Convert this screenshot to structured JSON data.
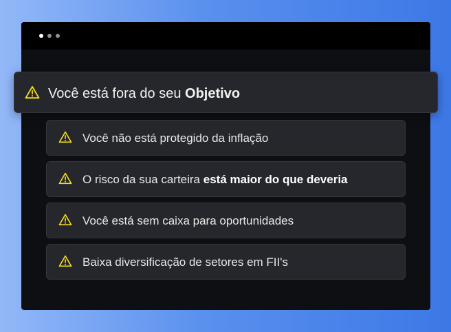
{
  "window": {
    "dots": [
      "active",
      "inactive",
      "inactive"
    ]
  },
  "alert": {
    "icon": "warning-triangle-icon",
    "text_regular": "Você está fora do seu ",
    "text_bold": "Objetivo"
  },
  "items": [
    {
      "icon": "warning-triangle-icon",
      "text_regular": "Você não está protegido da inflação",
      "text_bold": ""
    },
    {
      "icon": "warning-triangle-icon",
      "text_regular": "O risco da sua carteira ",
      "text_bold": "está maior do que deveria"
    },
    {
      "icon": "warning-triangle-icon",
      "text_regular": "Você está sem caixa para oportunidades",
      "text_bold": ""
    },
    {
      "icon": "warning-triangle-icon",
      "text_regular": "Baixa diversificação de setores em FII's",
      "text_bold": ""
    }
  ],
  "colors": {
    "warning": "#f5e11c",
    "panel": "#26272c",
    "window_bg": "#0e0f13"
  }
}
